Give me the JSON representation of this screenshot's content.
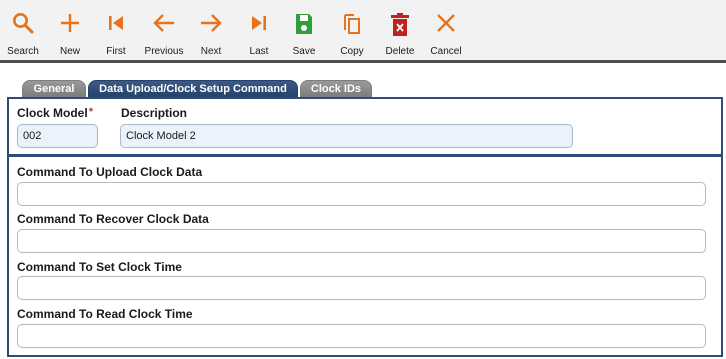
{
  "toolbar": {
    "buttons": [
      {
        "label": "Search",
        "icon": "search-icon"
      },
      {
        "label": "New",
        "icon": "plus-icon"
      },
      {
        "label": "First",
        "icon": "first-icon"
      },
      {
        "label": "Previous",
        "icon": "arrow-left-icon"
      },
      {
        "label": "Next",
        "icon": "arrow-right-icon"
      },
      {
        "label": "Last",
        "icon": "last-icon"
      },
      {
        "label": "Save",
        "icon": "save-icon"
      },
      {
        "label": "Copy",
        "icon": "copy-icon"
      },
      {
        "label": "Delete",
        "icon": "delete-icon"
      },
      {
        "label": "Cancel",
        "icon": "cancel-icon"
      }
    ]
  },
  "tabs": [
    {
      "label": "General",
      "active": false
    },
    {
      "label": "Data Upload/Clock Setup Command",
      "active": true
    },
    {
      "label": "Clock IDs",
      "active": false
    }
  ],
  "form": {
    "clock_model_label": "Clock Model",
    "required_mark": "*",
    "clock_model_value": "002",
    "description_label": "Description",
    "description_value": "Clock Model 2",
    "upload_label": "Command To Upload Clock Data",
    "upload_value": "",
    "recover_label": "Command To Recover Clock Data",
    "recover_value": "",
    "set_time_label": "Command To Set Clock Time",
    "set_time_value": "",
    "read_time_label": "Command To Read Clock Time",
    "read_time_value": ""
  },
  "colors": {
    "accent_orange": "#e8731a",
    "save_green": "#2e9e3f",
    "delete_red": "#c0221f",
    "panel_border": "#2d4c78"
  }
}
